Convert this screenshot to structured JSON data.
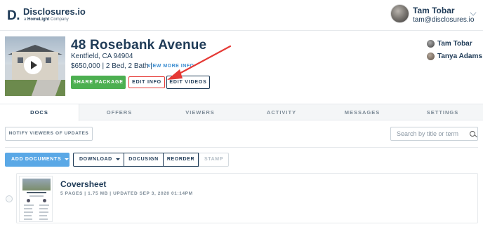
{
  "header": {
    "logo_mark": "D.",
    "app_name": "Disclosures.io",
    "tagline_prefix": "a",
    "tagline_brand": "HomeLight",
    "tagline_suffix": "Company",
    "user_name": "Tam Tobar",
    "user_email": "tam@disclosures.io"
  },
  "property": {
    "address": "48 Rosebank Avenue",
    "city": "Kentfield, CA 94904",
    "details": "$650,000 | 2 Bed, 2 Bath |",
    "view_more_label": "VIEW MORE INFO",
    "share_label": "SHARE PACKAGE",
    "edit_info_label": "EDIT INFO",
    "edit_videos_label": "EDIT VIDEOS",
    "agents": [
      "Tam Tobar",
      "Tanya Adams"
    ]
  },
  "tabs": [
    {
      "label": "DOCS",
      "active": true
    },
    {
      "label": "OFFERS",
      "active": false
    },
    {
      "label": "VIEWERS",
      "active": false
    },
    {
      "label": "ACTIVITY",
      "active": false
    },
    {
      "label": "MESSAGES",
      "active": false
    },
    {
      "label": "SETTINGS",
      "active": false
    }
  ],
  "toolbar": {
    "notify_label": "NOTIFY VIEWERS OF UPDATES",
    "search_placeholder": "Search by title or term",
    "add_documents_label": "ADD DOCUMENTS",
    "download_label": "DOWNLOAD",
    "docusign_label": "DOCUSIGN",
    "reorder_label": "REORDER",
    "stamp_label": "STAMP"
  },
  "documents": [
    {
      "title": "Coversheet",
      "meta": "5 PAGES | 1.75 MB | UPDATED SEP 3, 2020 01:14PM"
    }
  ],
  "colors": {
    "brand_navy": "#1f3b57",
    "share_green": "#4caf50",
    "add_blue": "#5aa8e6",
    "highlight_red": "#e53935",
    "link_blue": "#3d8ed1"
  }
}
